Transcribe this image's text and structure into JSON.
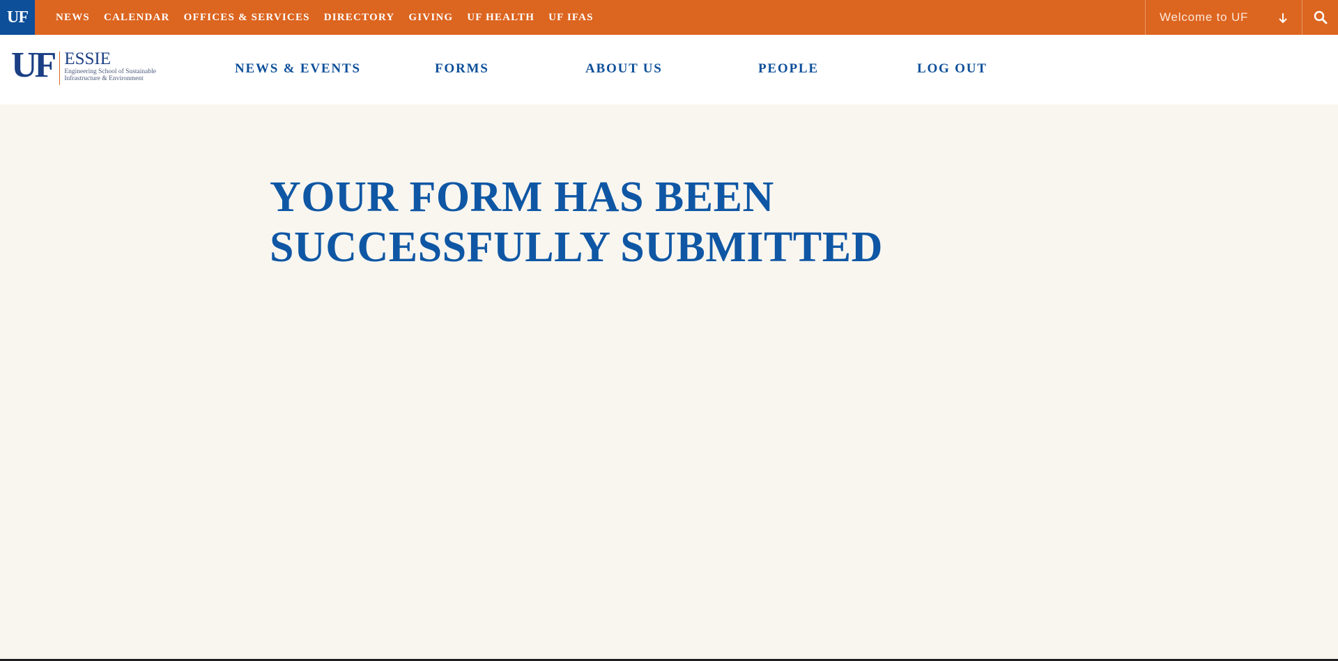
{
  "utility_bar": {
    "brand": "UF",
    "links": [
      "NEWS",
      "CALENDAR",
      "OFFICES & SERVICES",
      "DIRECTORY",
      "GIVING",
      "UF HEALTH",
      "UF IFAS"
    ],
    "welcome": "Welcome to UF",
    "colors": {
      "bar": "#dc6520",
      "brand_square": "#0d4f99"
    }
  },
  "header": {
    "logo": {
      "mark": "UF",
      "name": "ESSIE",
      "subtitle_line1": "Engineering School of Sustainable",
      "subtitle_line2": "Infrastructure & Environment"
    },
    "nav": [
      "NEWS & EVENTS",
      "FORMS",
      "ABOUT US",
      "PEOPLE",
      "LOG OUT"
    ]
  },
  "main": {
    "heading_line1": "YOUR FORM HAS BEEN",
    "heading_line2": "SUCCESSFULLY SUBMITTED",
    "colors": {
      "heading": "#0f57a4",
      "background": "#f9f6f0"
    }
  },
  "icons": {
    "dropdown": "arrow-down-icon",
    "search": "search-icon"
  }
}
